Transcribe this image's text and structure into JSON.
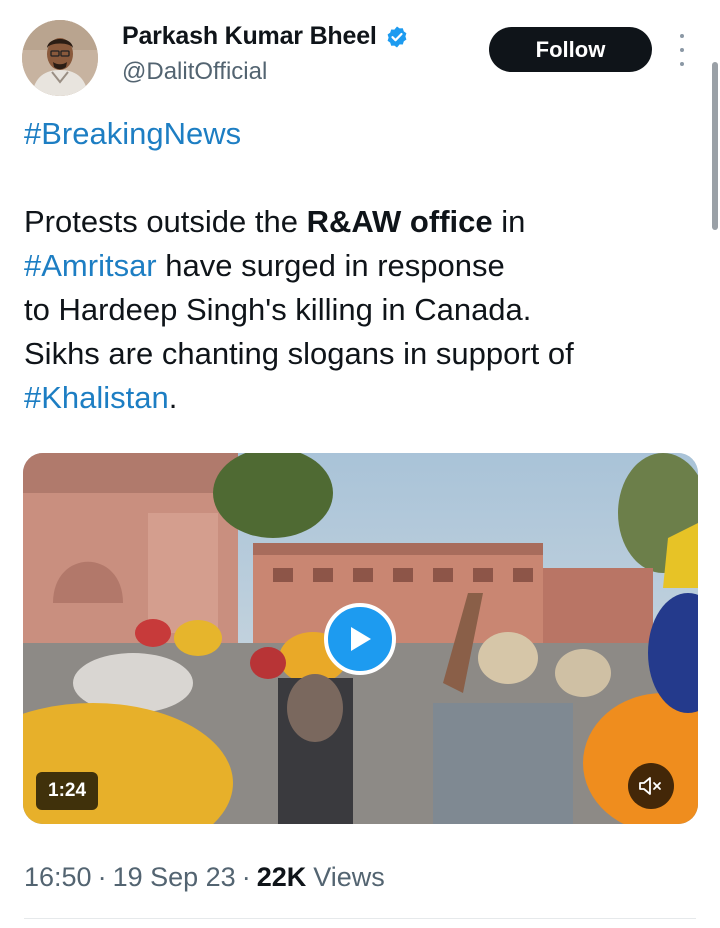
{
  "author": {
    "display_name": "Parkash Kumar Bheel",
    "handle": "@DalitOfficial",
    "verified": true,
    "avatar": "profile-photo"
  },
  "actions": {
    "follow_label": "Follow",
    "more_icon": "vertical-ellipsis-icon"
  },
  "tweet": {
    "tag_line": "#BreakingNews",
    "body": {
      "part1": "Protests outside the ",
      "bold_office": "R&AW office",
      "part2": " in",
      "hashtag_city": "#Amritsar",
      "part3": " have surged in response",
      "line3": "to Hardeep Singh's killing in Canada.",
      "line4": "Sikhs are chanting slogans in support of",
      "hashtag_cause": "#Khalistan",
      "end": "."
    }
  },
  "media": {
    "type": "video",
    "duration": "1:24",
    "play_icon": "play-icon",
    "mute_icon": "speaker-muted-icon"
  },
  "meta": {
    "time": "16:50",
    "separator": "·",
    "date": "19 Sep 23",
    "views_count": "22K",
    "views_label": "Views"
  },
  "colors": {
    "link": "#1d7ec3",
    "follow_bg": "#0f1419",
    "play_bg": "#1d9bf0",
    "secondary_text": "#536471"
  }
}
